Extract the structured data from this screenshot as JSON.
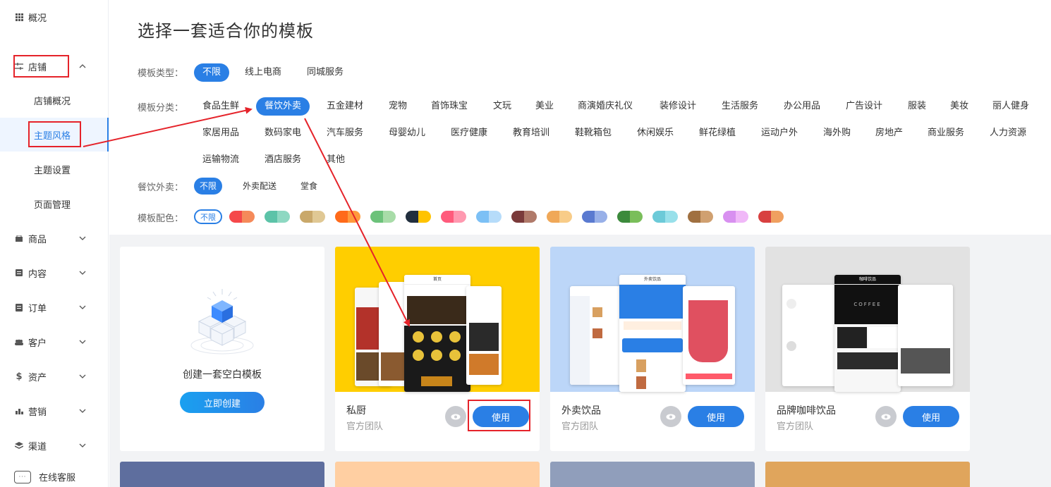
{
  "sidebar": {
    "overview": "概况",
    "shop": "店铺",
    "shop_sub": [
      "店铺概况",
      "主题风格",
      "主题设置",
      "页面管理"
    ],
    "goods": "商品",
    "content": "内容",
    "orders": "订单",
    "customers": "客户",
    "assets": "资产",
    "marketing": "营销",
    "channels": "渠道",
    "online_service": "在线客服"
  },
  "page": {
    "title": "选择一套适合你的模板"
  },
  "filters": {
    "type_label": "模板类型：",
    "types": [
      "不限",
      "线上电商",
      "同城服务"
    ],
    "category_label": "模板分类：",
    "categories_row1": [
      "食品生鲜",
      "餐饮外卖",
      "五金建材",
      "宠物",
      "首饰珠宝",
      "文玩",
      "美业",
      "商演婚庆礼仪",
      "装修设计",
      "生活服务",
      "办公用品",
      "广告设计",
      "服装",
      "美妆",
      "丽人健身"
    ],
    "categories_row2": [
      "家居用品",
      "数码家电",
      "汽车服务",
      "母婴幼儿",
      "医疗健康",
      "教育培训",
      "鞋靴箱包",
      "休闲娱乐",
      "鲜花绿植",
      "运动户外",
      "海外购",
      "房地产",
      "商业服务",
      "人力资源"
    ],
    "categories_row3": [
      "运输物流",
      "酒店服务",
      "其他"
    ],
    "sub_label": "餐饮外卖：",
    "subs": [
      "不限",
      "外卖配送",
      "堂食"
    ],
    "color_label": "模板配色：",
    "color_any": "不限",
    "colors": [
      [
        "#f5484a",
        "#f58a5a"
      ],
      [
        "#5cc3a8",
        "#8ed8c2"
      ],
      [
        "#c9a86a",
        "#e0c894"
      ],
      [
        "#ff6a1a",
        "#ff9a3c"
      ],
      [
        "#6cc27a",
        "#a8dca8"
      ],
      [
        "#222f3e",
        "#ffc300"
      ],
      [
        "#ff5b7c",
        "#ff99b0"
      ],
      [
        "#7cc0f5",
        "#b6dcfa"
      ],
      [
        "#7a3a3a",
        "#b07a6a"
      ],
      [
        "#f0a858",
        "#f8cc88"
      ],
      [
        "#5a7ad0",
        "#98b0e8"
      ],
      [
        "#3c8a3c",
        "#7abe5a"
      ],
      [
        "#6ccad8",
        "#98e0ea"
      ],
      [
        "#a07040",
        "#d0a070"
      ],
      [
        "#d890f0",
        "#f0b8f8"
      ],
      [
        "#d84040",
        "#f0a060"
      ]
    ]
  },
  "blank_template": {
    "text": "创建一套空白模板",
    "button": "立即创建"
  },
  "templates": [
    {
      "name": "私厨",
      "team": "官方团队",
      "use": "使用",
      "bg": "#ffce00"
    },
    {
      "name": "外卖饮品",
      "team": "官方团队",
      "use": "使用",
      "bg": "#bcd6f8"
    },
    {
      "name": "品牌咖啡饮品",
      "team": "官方团队",
      "use": "使用",
      "bg": "#e2e2e2"
    }
  ],
  "bottom_cards": [
    "#5e6e9e",
    "#ffcfa2",
    "#909ebb",
    "#e0a55c"
  ],
  "mock": {
    "p1_title": "首页",
    "p2_title": "外卖饮品",
    "p3_title": "咖啡饮品",
    "p3_coffee": "COFFEE"
  }
}
